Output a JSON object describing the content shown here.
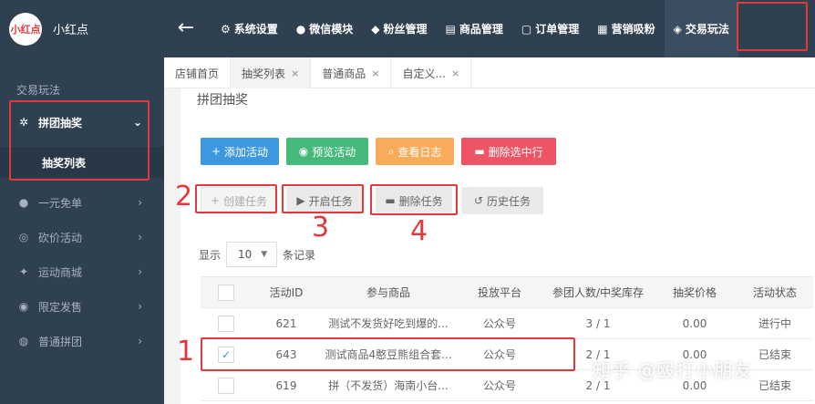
{
  "brand": {
    "logo_text": "小红点",
    "name": "小红点"
  },
  "nav": [
    {
      "icon": "⚙",
      "label": "系统设置"
    },
    {
      "icon": "●",
      "label": "微信模块"
    },
    {
      "icon": "◆",
      "label": "粉丝管理"
    },
    {
      "icon": "▤",
      "label": "商品管理"
    },
    {
      "icon": "▢",
      "label": "订单管理"
    },
    {
      "icon": "▦",
      "label": "营销吸粉"
    },
    {
      "icon": "◈",
      "label": "交易玩法"
    }
  ],
  "sidebar": {
    "title": "交易玩法",
    "group": {
      "icon": "✲",
      "label": "拼团抽奖",
      "chev": "⌄",
      "sub": "抽奖列表"
    },
    "items": [
      {
        "icon": "●",
        "label": "一元免单"
      },
      {
        "icon": "◎",
        "label": "砍价活动"
      },
      {
        "icon": "✦",
        "label": "运动商城"
      },
      {
        "icon": "◉",
        "label": "限定发售"
      },
      {
        "icon": "◍",
        "label": "普通拼团"
      }
    ],
    "chev_right": "›"
  },
  "tabs": [
    {
      "label": "店铺首页",
      "closable": false
    },
    {
      "label": "抽奖列表",
      "closable": true
    },
    {
      "label": "普通商品",
      "closable": true
    },
    {
      "label": "自定义...",
      "closable": true
    }
  ],
  "tab_close": "×",
  "content": {
    "title": "拼团抽奖",
    "buttons_row1": [
      {
        "icon": "+",
        "label": "添加活动"
      },
      {
        "icon": "◉",
        "label": "预览活动"
      },
      {
        "icon": "⌕",
        "label": "查看日志"
      },
      {
        "icon": "▬",
        "label": "删除选中行"
      }
    ],
    "buttons_row2": [
      {
        "icon": "+",
        "label": "创建任务"
      },
      {
        "icon": "▶",
        "label": "开启任务"
      },
      {
        "icon": "▬",
        "label": "删除任务"
      },
      {
        "icon": "↺",
        "label": "历史任务"
      }
    ],
    "show_label": "显示",
    "page_size": "10",
    "records_label": "条记录",
    "table": {
      "headers": [
        "",
        "活动ID",
        "参与商品",
        "投放平台",
        "参团人数/中奖库存",
        "抽奖价格",
        "活动状态"
      ],
      "rows": [
        {
          "checked": false,
          "id": "621",
          "product": "测试不发货好吃到爆的...",
          "platform": "公众号",
          "count": "3 / 1",
          "price": "0.00",
          "status": "进行中"
        },
        {
          "checked": true,
          "id": "643",
          "product": "测试商品4憨豆熊组合套...",
          "platform": "公众号",
          "count": "2 / 1",
          "price": "0.00",
          "status": "已结束"
        },
        {
          "checked": false,
          "id": "619",
          "product": "拼（不发货）海南小台...",
          "platform": "公众号",
          "count": "2 / 1",
          "price": "0.00",
          "status": "已结束"
        }
      ]
    }
  },
  "check_mark": "✓",
  "annotations": [
    "1",
    "2",
    "3",
    "4"
  ],
  "watermark": "知乎 @殴打小朋友",
  "colors": {
    "sidebar_bg": "#2f4050",
    "accent_red": "#e4393c",
    "blue": "#3d98e0",
    "green": "#45b97c",
    "orange": "#f8ac59",
    "red": "#ed5565"
  }
}
